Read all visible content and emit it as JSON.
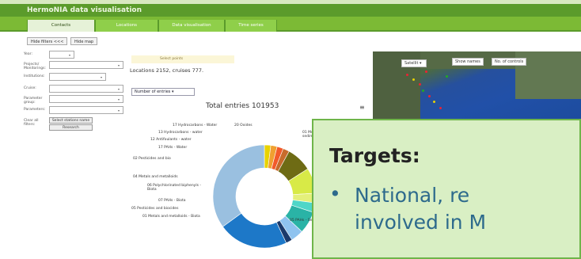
{
  "app": {
    "title": "HermoNIA data visualisation"
  },
  "tabs": [
    {
      "label": "Contacts",
      "active": true
    },
    {
      "label": "Locations",
      "active": false
    },
    {
      "label": "Data visualisation",
      "active": false
    },
    {
      "label": "Time series",
      "active": false
    }
  ],
  "toolbar": {
    "hide_filters": "Hide filters <<<",
    "hide_map": "Hide map"
  },
  "filters": [
    {
      "label": "Year:"
    },
    {
      "label": "Projects/ Monitorings:"
    },
    {
      "label": "Institutions:"
    },
    {
      "label": "Cruise:"
    },
    {
      "label": "Parameter group:"
    },
    {
      "label": "Parameters:"
    }
  ],
  "filter_actions": {
    "label": "Clear all filters:",
    "clear_button": "Select stations name",
    "search_button": "Research"
  },
  "main": {
    "note": "Select points",
    "counts": "Locations 2152, cruises 777.",
    "entries_select": "Number of entries"
  },
  "chart_data": {
    "type": "pie",
    "title": "Total entries 101953",
    "categories": [
      "17 Hydrocarbons - Water",
      "13 Hydrocarbons - water",
      "12 Antifoulants - water",
      "17 PAHs - Water",
      "02 Pesticides and bio",
      "04 Metals and metalloids",
      "06 Polychlorinated biphenyls - Biota",
      "07 PAHs - Biota",
      "03 Pesticides and biocides",
      "01 Metals and metalloids - Biota",
      "20 Oxides",
      "01 Metals and metalloids - sediments",
      "05 PAHs - Sed"
    ],
    "values": [
      2,
      2,
      2,
      2,
      8,
      8,
      3,
      3,
      7,
      4,
      2,
      22,
      35
    ],
    "colors": [
      "#e8d200",
      "#f0a030",
      "#f25a2a",
      "#c86b2c",
      "#6e6b14",
      "#d8ea47",
      "#e4f07a",
      "#4fd6c8",
      "#2ab3a6",
      "#8fc3ef",
      "#1b3a6b",
      "#1d78c8",
      "#9ac0e0"
    ]
  },
  "donut_labels": [
    "17 Hydrocarbons - Water",
    "13 Hydrocarbons - water",
    "12 Antifoulants - water",
    "17 PAHs - Water",
    "02 Pesticides and bio",
    "04 Metals and metalloids",
    "06 Polychlorinated biphenyls - Biota",
    "07 PAHs - Biota",
    "05 Pesticides and biocides",
    "01 Metals and metalloids - Biota",
    "20 Oxides",
    "01 Metals and - sediment",
    "05 PAHs - Sed"
  ],
  "map": {
    "type_label": "Satellit",
    "show_names": "Show names",
    "no_controls": "No. of controls"
  },
  "overlay": {
    "heading": "Targets:",
    "bullet": "•",
    "line1": "National, re",
    "line2": "involved in M"
  }
}
